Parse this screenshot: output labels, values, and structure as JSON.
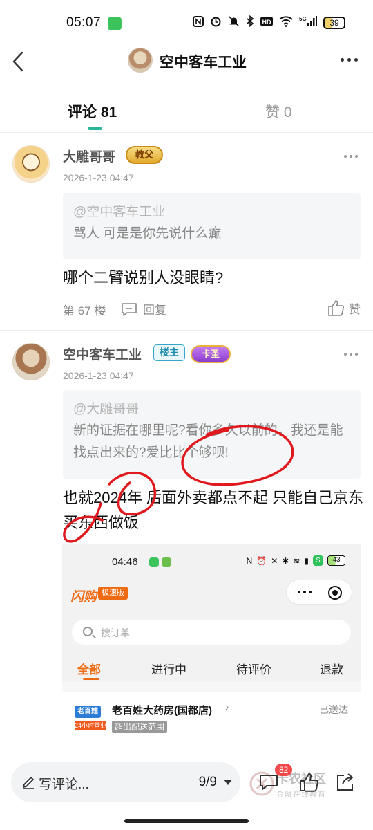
{
  "status_bar": {
    "time": "05:07",
    "network": "5G",
    "battery": "39",
    "icons": [
      "nfc-icon",
      "alarm-icon",
      "mute-icon",
      "bluetooth-icon",
      "hd-icon",
      "wifi-icon",
      "signal-icon",
      "battery-icon"
    ]
  },
  "header": {
    "title": "空中客车工业"
  },
  "tabs": [
    {
      "label": "评论 81",
      "active": true
    },
    {
      "label": "赞 0",
      "active": false
    }
  ],
  "comments": [
    {
      "username": "大雕哥哥",
      "badge": "教父",
      "timestamp": "2026-1-23 04:47",
      "quote_user": "@空中客车工业",
      "quote_text": "骂人 可是是你先说什么癫",
      "text": "哪个二臂说别人没眼睛?",
      "floor": "第 67 楼",
      "reply_label": "回复",
      "like_label": "赞"
    },
    {
      "username": "空中客车工业",
      "owner_badge": "楼主",
      "badge": "卡圣",
      "timestamp": "2026-1-23 04:47",
      "quote_user": "@大雕哥哥",
      "quote_text": "新的证据在哪里呢?看你多久以前的，我还是能找点出来的?爱比比个够呗!",
      "text": "也就2024年 后面外卖都点不起 只能自己京东买东西做饭"
    }
  ],
  "embedded_screenshot": {
    "time": "04:46",
    "battery": "43",
    "app_name": "闪购",
    "app_tag": "极速版",
    "search_placeholder": "搜订单",
    "tabs": [
      "全部",
      "进行中",
      "待评价",
      "退款"
    ],
    "store": {
      "logo_top": "老百姓",
      "logo_bottom": "24小时营业",
      "name": "老百姓大药房(国都店)",
      "tag": "超出配送范围",
      "status": "已送达"
    }
  },
  "bottom_bar": {
    "input_placeholder": "写评论...",
    "page_indicator": "9/9",
    "comment_count": "82",
    "watermark_title": "卡农社区",
    "watermark_sub": "金融在线教育"
  },
  "colors": {
    "accent": "#2bb59a",
    "annotation": "#e0191f",
    "flash_orange": "#f06a12"
  }
}
